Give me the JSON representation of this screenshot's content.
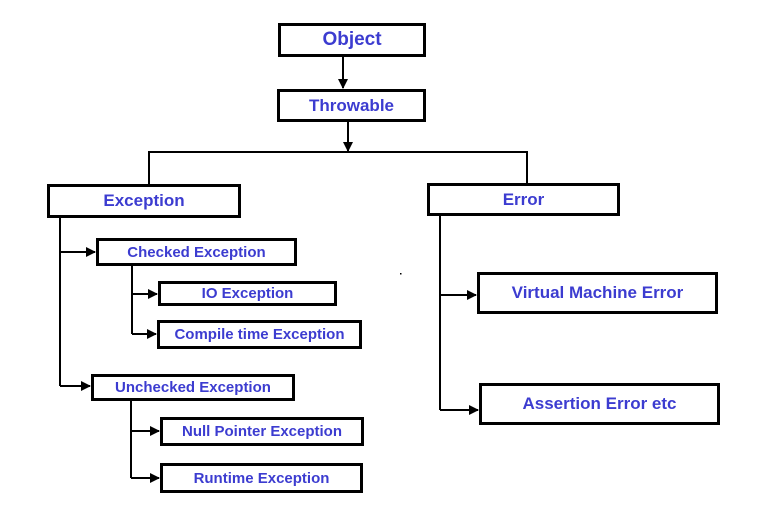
{
  "nodes": {
    "object": "Object",
    "throwable": "Throwable",
    "exception": "Exception",
    "error": "Error",
    "checked": "Checked Exception",
    "io": "IO Exception",
    "compile": "Compile time Exception",
    "unchecked": "Unchecked Exception",
    "null_pointer": "Null Pointer Exception",
    "runtime": "Runtime Exception",
    "virtual_machine": "Virtual Machine Error",
    "assertion": "Assertion Error etc"
  },
  "colors": {
    "text": "#3c3cd0",
    "border": "#000000"
  }
}
